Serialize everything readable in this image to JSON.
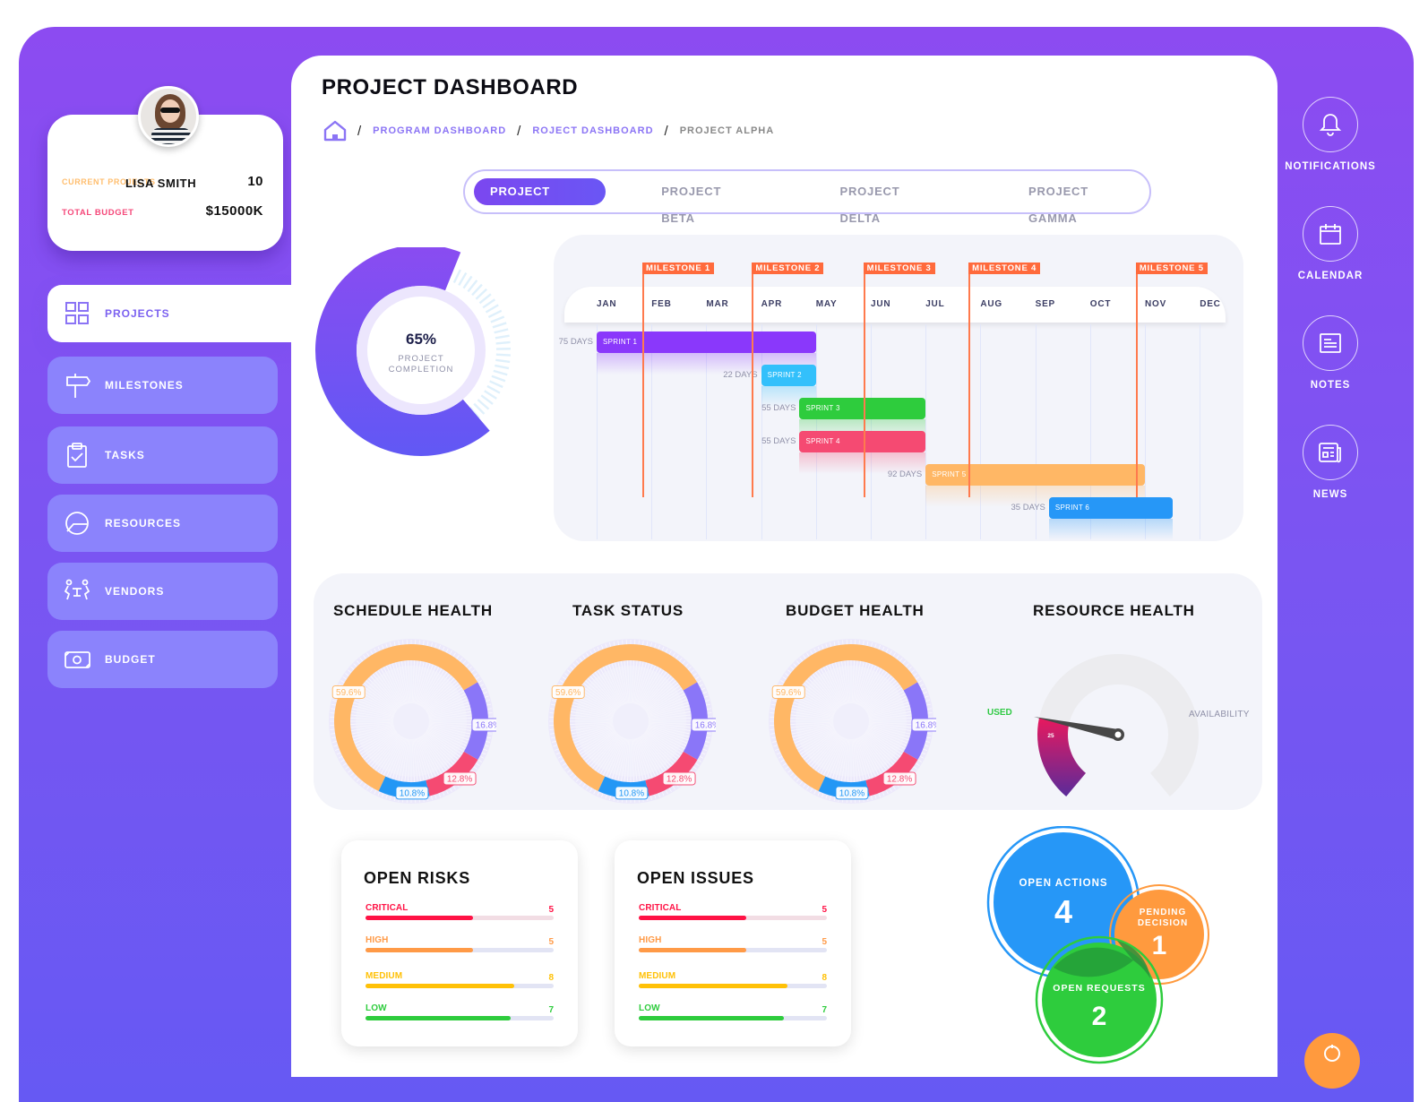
{
  "profile": {
    "name": "LISA SMITH",
    "current_projects_label": "CURRENT PROJECTS",
    "current_projects_value": "10",
    "total_budget_label": "TOTAL BUDGET",
    "total_budget_value": "$15000K"
  },
  "sidebar": {
    "items": [
      {
        "label": "PROJECTS",
        "icon": "grid-icon",
        "active": true
      },
      {
        "label": "MILESTONES",
        "icon": "signpost-icon",
        "active": false
      },
      {
        "label": "TASKS",
        "icon": "clipboard-check-icon",
        "active": false
      },
      {
        "label": "RESOURCES",
        "icon": "pie-chart-icon",
        "active": false
      },
      {
        "label": "VENDORS",
        "icon": "meeting-icon",
        "active": false
      },
      {
        "label": "BUDGET",
        "icon": "money-icon",
        "active": false
      }
    ]
  },
  "header": {
    "title": "PROJECT DASHBOARD",
    "breadcrumb": [
      {
        "label": "PROGRAM DASHBOARD"
      },
      {
        "label": "ROJECT DASHBOARD"
      },
      {
        "label": "PROJECT ALPHA"
      }
    ]
  },
  "tabs": [
    {
      "label": "PROJECT ALPHA",
      "active": true
    },
    {
      "label": "PROJECT BETA",
      "active": false
    },
    {
      "label": "PROJECT DELTA",
      "active": false
    },
    {
      "label": "PROJECT GAMMA",
      "active": false
    }
  ],
  "completion": {
    "percent": 65,
    "percent_label": "65%",
    "label_line1": "PROJECT",
    "label_line2": "COMPLETION",
    "colors": [
      "#8a4cf1",
      "#6158f4"
    ]
  },
  "gantt": {
    "months": [
      "JAN",
      "FEB",
      "MAR",
      "APR",
      "MAY",
      "JUN",
      "JUL",
      "AUG",
      "SEP",
      "OCT",
      "NOV",
      "DEC"
    ],
    "milestones": [
      {
        "label": "MILESTONE 1",
        "month_pos": 1.85
      },
      {
        "label": "MILESTONE 2",
        "month_pos": 3.85
      },
      {
        "label": "MILESTONE 3",
        "month_pos": 5.88
      },
      {
        "label": "MILESTONE 4",
        "month_pos": 7.8
      },
      {
        "label": "MILESTONE 5",
        "month_pos": 10.85
      }
    ],
    "sprints": [
      {
        "label": "SPRINT 1",
        "days_label": "75 DAYS",
        "start": 1.0,
        "end": 5.0,
        "color": "#8a38fb"
      },
      {
        "label": "SPRINT 2",
        "days_label": "22 DAYS",
        "start": 4.0,
        "end": 5.0,
        "color": "#33c0fb"
      },
      {
        "label": "SPRINT 3",
        "days_label": "55 DAYS",
        "start": 4.7,
        "end": 7.0,
        "color": "#2ecc3d"
      },
      {
        "label": "SPRINT 4",
        "days_label": "55 DAYS",
        "start": 4.7,
        "end": 7.0,
        "color": "#f54a72"
      },
      {
        "label": "SPRINT 5",
        "days_label": "92 DAYS",
        "start": 7.0,
        "end": 11.0,
        "color": "#ffb765"
      },
      {
        "label": "SPRINT 6",
        "days_label": "35 DAYS",
        "start": 9.25,
        "end": 11.5,
        "color": "#2697f7"
      }
    ]
  },
  "health": {
    "charts": [
      {
        "title": "SCHEDULE HEALTH",
        "segments": [
          {
            "value": 59.6,
            "label": "59.6%",
            "color": "#ffb765"
          },
          {
            "value": 16.8,
            "label": "16.8%",
            "color": "#8a76f8"
          },
          {
            "value": 12.8,
            "label": "12.8%",
            "color": "#f54a72"
          },
          {
            "value": 10.8,
            "label": "10.8%",
            "color": "#2397f5"
          }
        ]
      },
      {
        "title": "TASK STATUS",
        "segments": [
          {
            "value": 59.6,
            "label": "59.6%",
            "color": "#ffb765"
          },
          {
            "value": 16.8,
            "label": "16.8%",
            "color": "#8a76f8"
          },
          {
            "value": 12.8,
            "label": "12.8%",
            "color": "#f54a72"
          },
          {
            "value": 10.8,
            "label": "10.8%",
            "color": "#2397f5"
          }
        ]
      },
      {
        "title": "BUDGET HEALTH",
        "segments": [
          {
            "value": 59.6,
            "label": "59.6%",
            "color": "#ffb765"
          },
          {
            "value": 16.8,
            "label": "16.8%",
            "color": "#8a76f8"
          },
          {
            "value": 12.8,
            "label": "12.8%",
            "color": "#f54a72"
          },
          {
            "value": 10.8,
            "label": "10.8%",
            "color": "#2397f5"
          }
        ]
      }
    ],
    "resource": {
      "title": "RESOURCE HEALTH",
      "used_label": "USED",
      "availability_label": "AVAILABILITY",
      "value": 25,
      "value_label": "25",
      "max": 100
    }
  },
  "open_risks": {
    "title": "OPEN RISKS",
    "max": 10,
    "items": [
      {
        "label": "CRITICAL",
        "value": 5,
        "value_label": "5",
        "color": "#ff1245",
        "track": "#f2dde4"
      },
      {
        "label": "HIGH",
        "value": 5,
        "value_label": "5",
        "color": "#ff9a47",
        "track": "#e2e4f4"
      },
      {
        "label": "MEDIUM",
        "value": 8,
        "value_label": "8",
        "color": "#ffc107",
        "track": "#e2e4f4"
      },
      {
        "label": "LOW",
        "value": 7,
        "value_label": "7",
        "color": "#2ecc3d",
        "track": "#e2e4f4"
      }
    ]
  },
  "open_issues": {
    "title": "OPEN ISSUES",
    "max": 10,
    "items": [
      {
        "label": "CRITICAL",
        "value": 5,
        "value_label": "5",
        "color": "#ff1245",
        "track": "#f2dde4"
      },
      {
        "label": "HIGH",
        "value": 5,
        "value_label": "5",
        "color": "#ff9a47",
        "track": "#e2e4f4"
      },
      {
        "label": "MEDIUM",
        "value": 8,
        "value_label": "8",
        "color": "#ffc107",
        "track": "#e2e4f4"
      },
      {
        "label": "LOW",
        "value": 7,
        "value_label": "7",
        "color": "#2ecc3d",
        "track": "#e2e4f4"
      }
    ]
  },
  "summary_bubbles": [
    {
      "label": "OPEN ACTIONS",
      "value": "4",
      "color": "#2697f7"
    },
    {
      "label_line1": "PENDING",
      "label_line2": "DECISION",
      "value": "1",
      "color": "#ff9a3e"
    },
    {
      "label": "OPEN REQUESTS",
      "value": "2",
      "color": "#2ecc3d"
    }
  ],
  "right_rail": {
    "items": [
      {
        "label": "NOTIFICATIONS",
        "icon": "bell-icon"
      },
      {
        "label": "CALENDAR",
        "icon": "calendar-icon"
      },
      {
        "label": "NOTES",
        "icon": "notes-icon"
      },
      {
        "label": "NEWS",
        "icon": "news-icon"
      }
    ]
  }
}
